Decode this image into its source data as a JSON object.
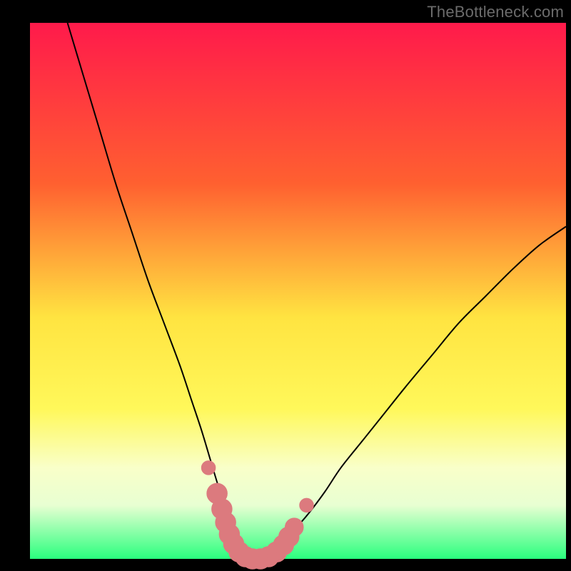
{
  "watermark": "TheBottleneck.com",
  "colors": {
    "frame_bg": "#000000",
    "gradient_top": "#ff1a4b",
    "gradient_mid1": "#ff8a2a",
    "gradient_mid2": "#ffe441",
    "gradient_pale": "#f9ffc9",
    "gradient_bottom": "#2aff7e",
    "curve_stroke": "#000000",
    "marker_fill": "#dc7a7e",
    "marker_stroke": "#dc7a7e"
  },
  "chart_data": {
    "type": "line",
    "title": "",
    "xlabel": "",
    "ylabel": "",
    "xlim": [
      0,
      100
    ],
    "ylim": [
      0,
      100
    ],
    "grid": false,
    "legend": false,
    "series": [
      {
        "name": "bottleneck-curve",
        "x": [
          7,
          10,
          13,
          16,
          19,
          22,
          25,
          28,
          30,
          32,
          33.5,
          35,
          36.3,
          37.5,
          38.5,
          39.5,
          40.5,
          41.5,
          43,
          45,
          47,
          49,
          52,
          55,
          58,
          62,
          66,
          70,
          75,
          80,
          85,
          90,
          95,
          100
        ],
        "y": [
          100,
          90,
          80,
          70,
          61,
          52,
          44,
          36,
          30,
          24,
          19,
          14,
          10,
          6.5,
          4,
          2,
          1,
          0.5,
          0.5,
          1,
          2.5,
          5,
          8.5,
          12.5,
          17,
          22,
          27,
          32,
          38,
          44,
          49,
          54,
          58.5,
          62
        ]
      }
    ],
    "markers": [
      {
        "x": 33.3,
        "y": 17.0,
        "r": 1.3
      },
      {
        "x": 34.9,
        "y": 12.2,
        "r": 1.9
      },
      {
        "x": 35.8,
        "y": 9.3,
        "r": 1.9
      },
      {
        "x": 36.5,
        "y": 6.8,
        "r": 1.9
      },
      {
        "x": 37.2,
        "y": 4.6,
        "r": 1.9
      },
      {
        "x": 38.0,
        "y": 2.8,
        "r": 1.9
      },
      {
        "x": 39.0,
        "y": 1.3,
        "r": 1.9
      },
      {
        "x": 40.2,
        "y": 0.4,
        "r": 1.9
      },
      {
        "x": 41.5,
        "y": 0.0,
        "r": 1.9
      },
      {
        "x": 43.0,
        "y": 0.0,
        "r": 1.9
      },
      {
        "x": 44.5,
        "y": 0.4,
        "r": 1.9
      },
      {
        "x": 46.0,
        "y": 1.3,
        "r": 1.9
      },
      {
        "x": 47.3,
        "y": 2.6,
        "r": 1.9
      },
      {
        "x": 48.3,
        "y": 4.1,
        "r": 1.9
      },
      {
        "x": 49.3,
        "y": 5.9,
        "r": 1.7
      },
      {
        "x": 51.6,
        "y": 10.0,
        "r": 1.3
      }
    ]
  }
}
